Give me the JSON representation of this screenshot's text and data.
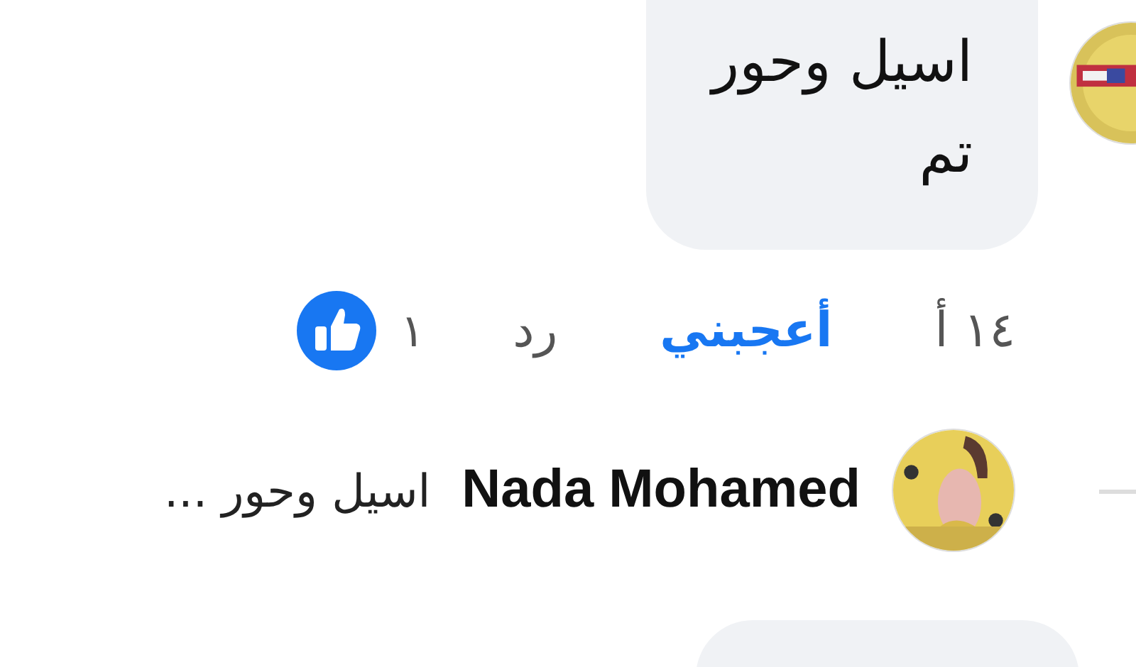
{
  "comment": {
    "text": "اسيل وحور\nتم"
  },
  "actions": {
    "time": "١٤ أ",
    "like": {
      "label": "أعجبني",
      "selected": true
    },
    "reply": "رد",
    "reaction_count": "١"
  },
  "reply_preview": {
    "author": "Nada Mohamed",
    "text": "اسيل وحور ..."
  },
  "next_comment": {
    "kind": "bubble"
  }
}
